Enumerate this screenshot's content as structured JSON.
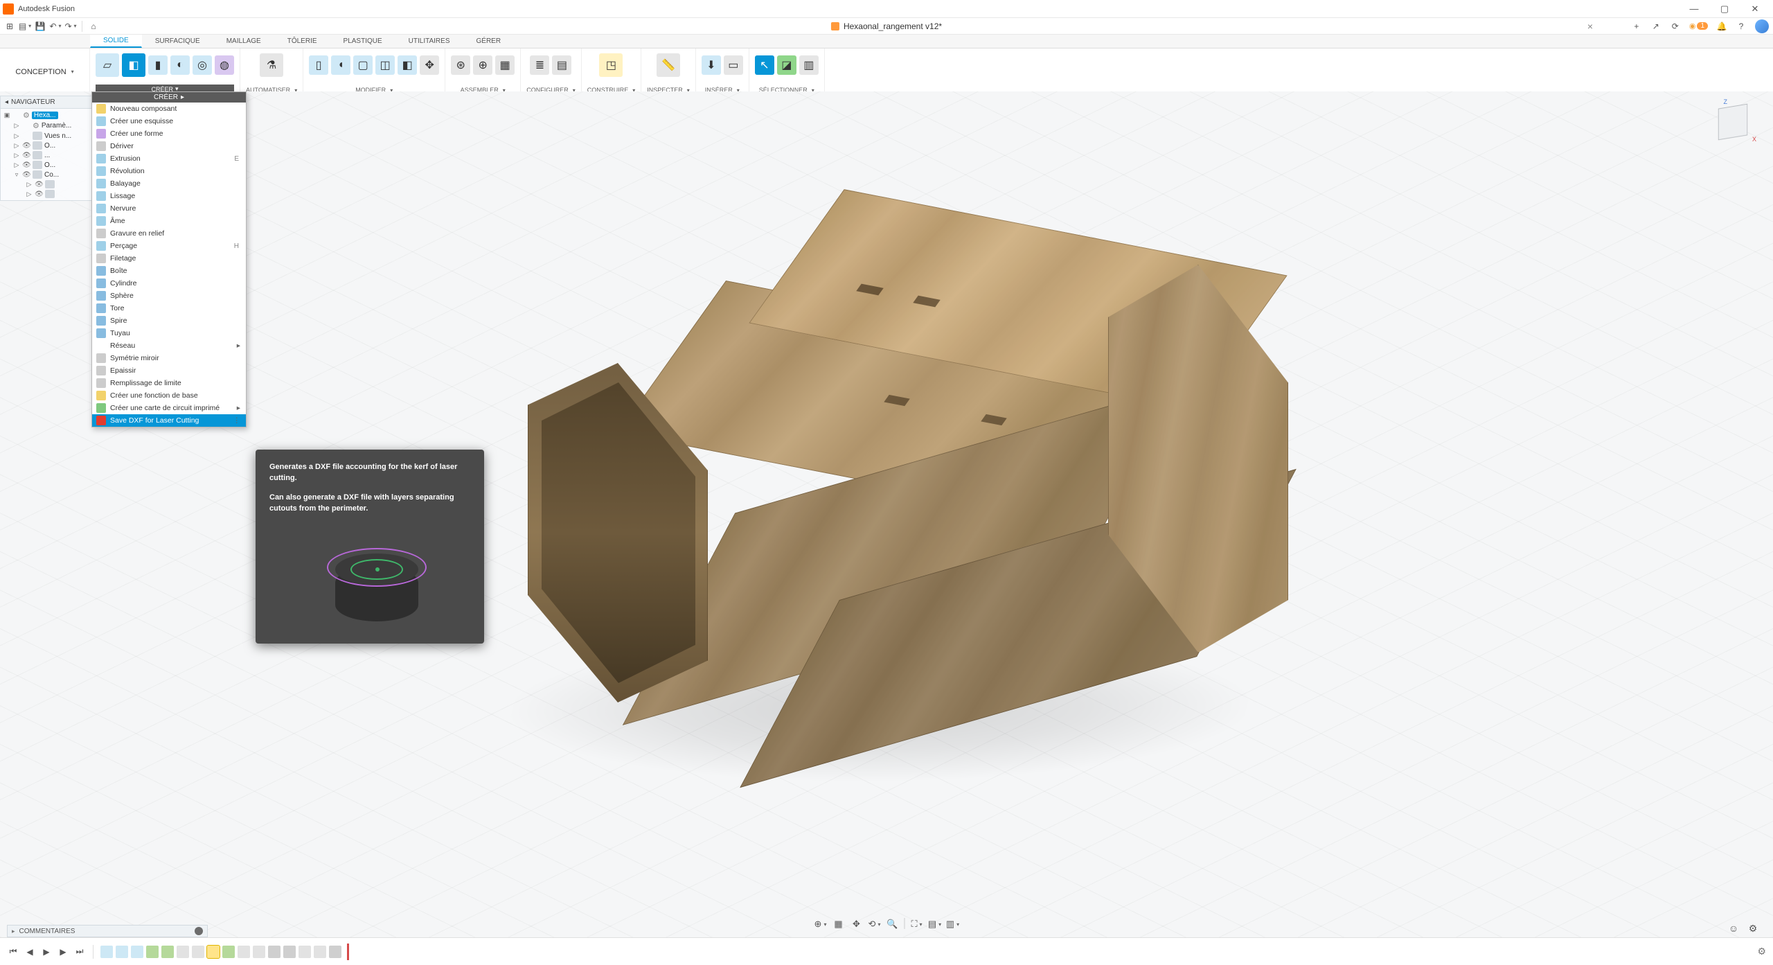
{
  "app": {
    "title": "Autodesk Fusion"
  },
  "window_controls": {
    "min": "—",
    "max": "▢",
    "close": "✕"
  },
  "qa": {
    "grid": "⊞",
    "file": "▤",
    "save": "💾",
    "undo": "↶",
    "redo": "↷",
    "home": "⌂",
    "new_tab": "+",
    "ext": "↗",
    "updates": "⟳",
    "job_count": "1",
    "notif": "🔔",
    "help": "?"
  },
  "document": {
    "name": "Hexaonal_rangement v12*",
    "close": "×"
  },
  "workspace": {
    "button": "CONCEPTION"
  },
  "ws_tabs": [
    "SOLIDE",
    "SURFACIQUE",
    "MAILLAGE",
    "TÔLERIE",
    "PLASTIQUE",
    "UTILITAIRES",
    "GÉRER"
  ],
  "ws_active": 0,
  "ribbon": {
    "groups": [
      {
        "label": "CRÉER",
        "active": true
      },
      {
        "label": "AUTOMATISER"
      },
      {
        "label": "MODIFIER"
      },
      {
        "label": "ASSEMBLER"
      },
      {
        "label": "CONFIGURER"
      },
      {
        "label": "CONSTRUIRE"
      },
      {
        "label": "INSPECTER"
      },
      {
        "label": "INSÉRER"
      },
      {
        "label": "SÉLECTIONNER"
      }
    ]
  },
  "browser": {
    "title": "NAVIGATEUR",
    "items": [
      {
        "label": "Hexa...",
        "sel": true,
        "depth": 0,
        "tri": "▣",
        "gear": true
      },
      {
        "label": "Paramè...",
        "depth": 1,
        "tri": "▷",
        "gear": true
      },
      {
        "label": "Vues n...",
        "depth": 1,
        "tri": "▷",
        "folder": true
      },
      {
        "label": "O...",
        "depth": 1,
        "tri": "▷",
        "folder": true,
        "eye": true
      },
      {
        "label": "...",
        "depth": 1,
        "tri": "▷",
        "folder": true,
        "eye": true
      },
      {
        "label": "O...",
        "depth": 1,
        "tri": "▷",
        "folder": true,
        "eye": true
      },
      {
        "label": "Co...",
        "depth": 1,
        "tri": "▿",
        "folder": true,
        "eye": true
      },
      {
        "label": "",
        "depth": 2,
        "tri": "▷",
        "folder": true,
        "eye": true
      },
      {
        "label": "",
        "depth": 2,
        "tri": "▷",
        "folder": true,
        "eye": true
      }
    ]
  },
  "create_menu": {
    "header": "CRÉER",
    "items": [
      {
        "label": "Nouveau composant",
        "icon": "comp"
      },
      {
        "label": "Créer une esquisse",
        "icon": "sketch"
      },
      {
        "label": "Créer une forme",
        "icon": "form"
      },
      {
        "label": "Dériver",
        "icon": "deriv"
      },
      {
        "label": "Extrusion",
        "icon": "extr",
        "shortcut": "E"
      },
      {
        "label": "Révolution",
        "icon": "rev"
      },
      {
        "label": "Balayage",
        "icon": "sweep"
      },
      {
        "label": "Lissage",
        "icon": "loft"
      },
      {
        "label": "Nervure",
        "icon": "rib"
      },
      {
        "label": "Âme",
        "icon": "web"
      },
      {
        "label": "Gravure en relief",
        "icon": "emb"
      },
      {
        "label": "Perçage",
        "icon": "hole",
        "shortcut": "H"
      },
      {
        "label": "Filetage",
        "icon": "thr"
      },
      {
        "label": "Boîte",
        "icon": "box"
      },
      {
        "label": "Cylindre",
        "icon": "cyl"
      },
      {
        "label": "Sphère",
        "icon": "sph"
      },
      {
        "label": "Tore",
        "icon": "tor"
      },
      {
        "label": "Spire",
        "icon": "coil"
      },
      {
        "label": "Tuyau",
        "icon": "pipe"
      },
      {
        "label": "Réseau",
        "submenu": true
      },
      {
        "label": "Symétrie miroir",
        "icon": "mir"
      },
      {
        "label": "Epaissir",
        "icon": "thk"
      },
      {
        "label": "Remplissage de limite",
        "icon": "bnd"
      },
      {
        "label": "Créer une fonction de base",
        "icon": "base"
      },
      {
        "label": "Créer une carte de circuit imprimé",
        "icon": "pcb",
        "submenu": true
      },
      {
        "label": "Save DXF for Laser Cutting",
        "icon": "dxf",
        "highlight": true,
        "more": true
      }
    ]
  },
  "tooltip": {
    "line1": "Generates a DXF file accounting for the kerf of laser cutting.",
    "line2": "Can also generate a DXF file with layers separating cutouts from the perimeter."
  },
  "comments": {
    "label": "COMMENTAIRES"
  },
  "timeline": {
    "controls": {
      "start": "⏮",
      "prev": "◀",
      "play": "▶",
      "next": "▶",
      "end": "⏭"
    },
    "items": [
      "sk",
      "sk",
      "sk",
      "ex",
      "ex",
      "op",
      "op",
      "sel",
      "ex",
      "op",
      "op",
      "mr",
      "mr",
      "op",
      "op",
      "mr"
    ]
  },
  "viewbar_icons": [
    "⊕",
    "▦",
    "✥",
    "⟲",
    "🔍",
    "⛶",
    "▤",
    "▥",
    "▦"
  ],
  "axes": {
    "z": "Z",
    "x": "X"
  }
}
